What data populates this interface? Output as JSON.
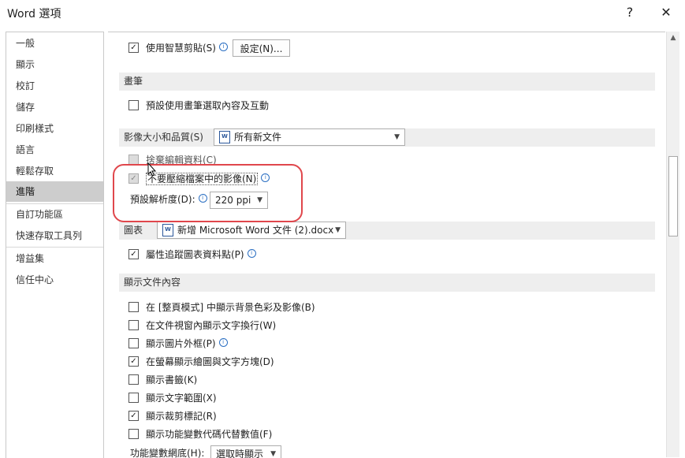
{
  "window": {
    "title": "Word 選項",
    "help": "?",
    "close": "✕"
  },
  "sidebar": {
    "items": [
      {
        "label": "一般"
      },
      {
        "label": "顯示"
      },
      {
        "label": "校訂"
      },
      {
        "label": "儲存"
      },
      {
        "label": "印刷樣式"
      },
      {
        "label": "語言"
      },
      {
        "label": "輕鬆存取"
      },
      {
        "label": "進階"
      },
      {
        "label": "自訂功能區"
      },
      {
        "label": "快速存取工具列"
      },
      {
        "label": "增益集"
      },
      {
        "label": "信任中心"
      }
    ],
    "active": "進階"
  },
  "smart_cut": {
    "label": "使用智慧剪貼(S)",
    "checked": true,
    "settings_button": "設定(N)..."
  },
  "pen": {
    "header": "畫筆",
    "default_pen_label": "預設使用畫筆選取內容及互動",
    "checked": false
  },
  "image_size": {
    "header": "影像大小和品質(S)",
    "scope": "所有新文件",
    "discard_label": "捨棄編輯資料(C)",
    "compress_label": "不要壓縮檔案中的影像(N)",
    "resolution_label": "預設解析度(D):",
    "resolution_value": "220 ppi"
  },
  "chart": {
    "header": "圖表",
    "scope": "新增 Microsoft Word 文件 (2).docx",
    "track_label": "屬性追蹤圖表資料點(P)",
    "checked": true
  },
  "display_content": {
    "header": "顯示文件內容",
    "options": [
      {
        "label": "在 [整頁模式] 中顯示背景色彩及影像(B)",
        "checked": false,
        "info": false
      },
      {
        "label": "在文件視窗內顯示文字換行(W)",
        "checked": false,
        "info": false
      },
      {
        "label": "顯示圖片外框(P)",
        "checked": false,
        "info": true
      },
      {
        "label": "在螢幕顯示繪圖與文字方塊(D)",
        "checked": true,
        "info": false
      },
      {
        "label": "顯示書籤(K)",
        "checked": false,
        "info": false
      },
      {
        "label": "顯示文字範圍(X)",
        "checked": false,
        "info": false
      },
      {
        "label": "顯示裁剪標記(R)",
        "checked": true,
        "info": false
      },
      {
        "label": "顯示功能變數代碼代替數值(F)",
        "checked": false,
        "info": false
      }
    ],
    "field_shading_label": "功能變數網底(H):",
    "field_shading_value": "選取時顯示"
  },
  "icons": {
    "check": "✓",
    "dropdown": "▼",
    "info": "i",
    "scroll_up": "▲"
  },
  "colors": {
    "annotation": "#e0474c",
    "info": "#2b6fc2",
    "active_nav": "#cdcdcd"
  }
}
